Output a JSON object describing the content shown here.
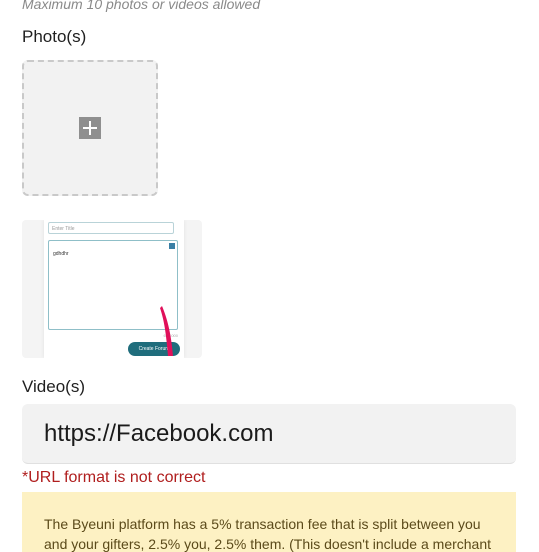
{
  "media": {
    "hint": "Maximum 10 photos or videos allowed",
    "photos_label": "Photo(s)",
    "add_icon": "plus-icon",
    "thumbnail": {
      "title_placeholder": "Enter Title",
      "body_text": "gdhdhr",
      "counter": "6 / 1000",
      "button_label": "Create Forum"
    }
  },
  "video": {
    "label": "Video(s)",
    "url_value": "https://Facebook.com",
    "error": "*URL format is not correct"
  },
  "notice": {
    "text": "The Byeuni platform has a 5% transaction fee that is split between you and your gifters, 2.5% you, 2.5% them. (This doesn't include a merchant"
  }
}
